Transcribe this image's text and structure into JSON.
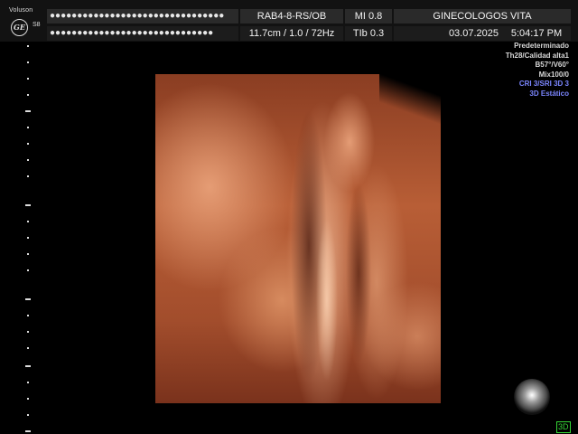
{
  "header": {
    "brand": "Voluson",
    "logo": "GE",
    "sb": "S8",
    "patient_name_masked": "●●●●●●●●●●●●●●●●●●●●●●●●●●●●●●●●",
    "patient_id_masked": "●●●●●●●●●●●●●●●●●●●●●●●●●●●●●●",
    "probe": "RAB4-8-RS/OB",
    "mi": "MI  0.8",
    "depth_freq": "11.7cm / 1.0 / 72Hz",
    "tib": "TIb  0.3",
    "institution": "GINECOLOGOS VITA",
    "date": "03.07.2025",
    "time": "5:04:17 PM"
  },
  "info_panel": {
    "line1": "Predeterminado",
    "line2": "Th28/Calidad alta1",
    "line3": "B57°/V60°",
    "line4": "Mix100/0",
    "line5": "CRI 3/SRI 3D 3",
    "line6": "3D Estático",
    "highlight_color": "#7b86ff"
  },
  "render_view": {
    "description_icon": "3d-fetal-render"
  },
  "mode_indicator": "3D"
}
